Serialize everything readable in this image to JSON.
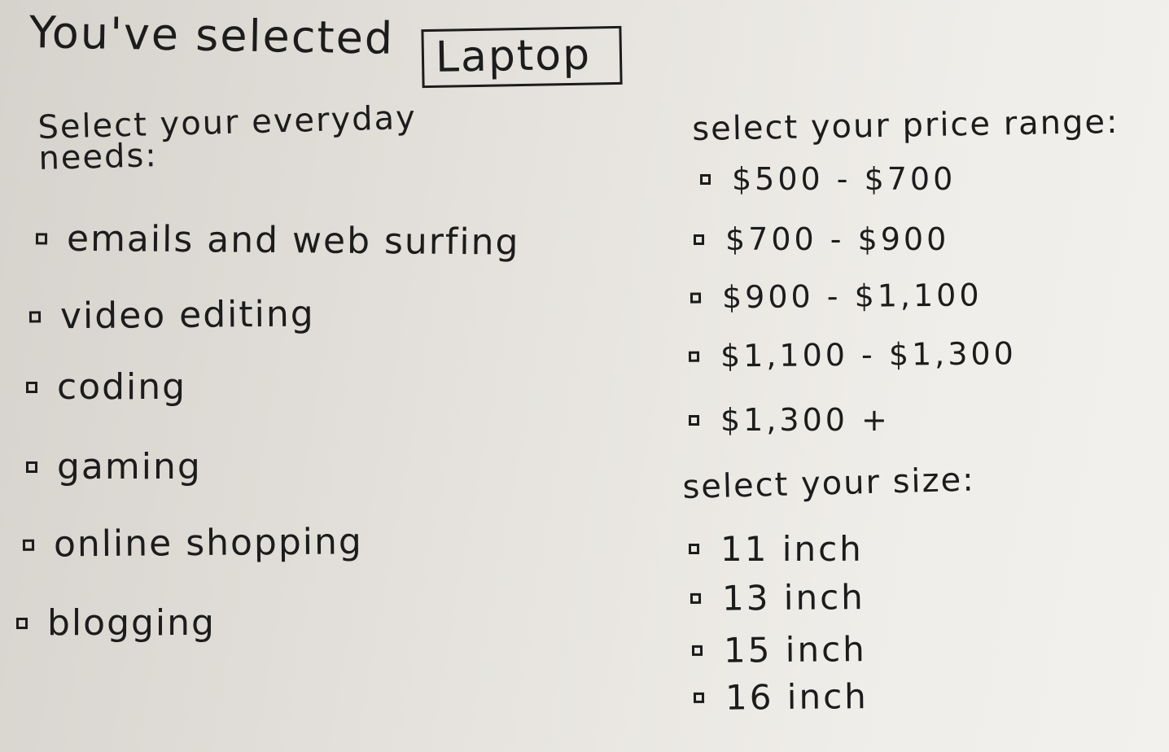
{
  "header": {
    "prefix": "You've selected",
    "selected_device": "Laptop"
  },
  "needs": {
    "heading": "Select your everyday needs:",
    "options": [
      {
        "label": "emails and web surfing",
        "checked": false
      },
      {
        "label": "video editing",
        "checked": false
      },
      {
        "label": "coding",
        "checked": false
      },
      {
        "label": "gaming",
        "checked": false
      },
      {
        "label": "online shopping",
        "checked": false
      },
      {
        "label": "blogging",
        "checked": false
      }
    ]
  },
  "price": {
    "heading": "select your price range:",
    "options": [
      {
        "label": "$500 - $700",
        "checked": false
      },
      {
        "label": "$700 - $900",
        "checked": false
      },
      {
        "label": "$900 - $1,100",
        "checked": false
      },
      {
        "label": "$1,100 - $1,300",
        "checked": false
      },
      {
        "label": "$1,300 +",
        "checked": false
      }
    ]
  },
  "size": {
    "heading": "select your size:",
    "options": [
      {
        "label": "11 inch",
        "checked": false
      },
      {
        "label": "13 inch",
        "checked": false
      },
      {
        "label": "15 inch",
        "checked": false
      },
      {
        "label": "16 inch",
        "checked": false
      }
    ]
  },
  "colors": {
    "ink": "#1c1c1c",
    "paper": "#e6e3de"
  }
}
